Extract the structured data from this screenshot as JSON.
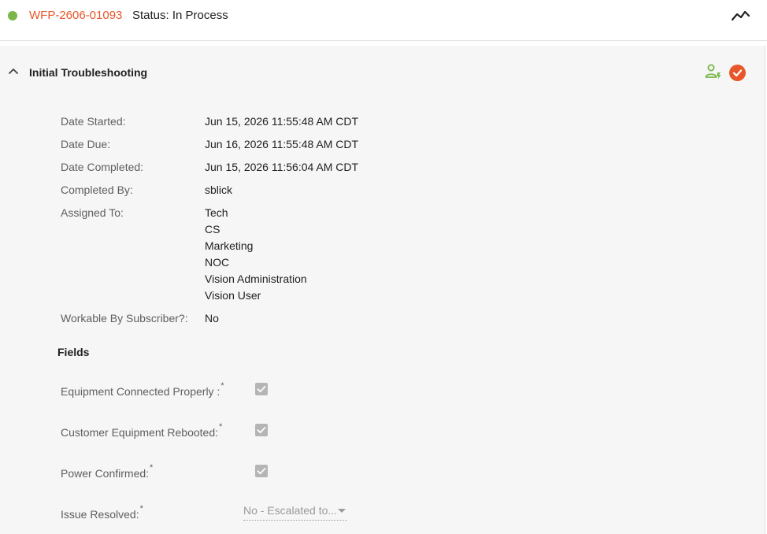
{
  "header": {
    "work_order_id": "WFP-2606-01093",
    "status_text": "Status: In Process",
    "status_color": "#7ab648",
    "trend_icon": "trend-line-icon"
  },
  "task": {
    "title": "Initial Troubleshooting",
    "collapse_icon": "chevron-up-icon",
    "assign_icon": "user-action-icon",
    "complete_icon": "check-circle-icon",
    "complete_color": "#e8562a",
    "details": {
      "date_started_label": "Date Started:",
      "date_started": "Jun 15, 2026 11:55:48 AM CDT",
      "date_due_label": "Date Due:",
      "date_due": "Jun 16, 2026 11:55:48 AM CDT",
      "date_completed_label": "Date Completed:",
      "date_completed": "Jun 15, 2026 11:56:04 AM CDT",
      "completed_by_label": "Completed By:",
      "completed_by": "sblick",
      "assigned_to_label": "Assigned To:",
      "assigned_to": [
        "Tech",
        "CS",
        "Marketing",
        "NOC",
        "Vision Administration",
        "Vision User"
      ],
      "workable_label": "Workable By Subscriber?:",
      "workable": "No"
    },
    "fields_heading": "Fields",
    "fields": [
      {
        "label": "Equipment Connected Properly :",
        "required": "*",
        "type": "checkbox",
        "checked": true
      },
      {
        "label": "Customer Equipment Rebooted:",
        "required": "*",
        "type": "checkbox",
        "checked": true
      },
      {
        "label": "Power Confirmed:",
        "required": "*",
        "type": "checkbox",
        "checked": true
      },
      {
        "label": "Issue Resolved:",
        "required": "*",
        "type": "select",
        "value": "No - Escalated to..."
      }
    ]
  }
}
